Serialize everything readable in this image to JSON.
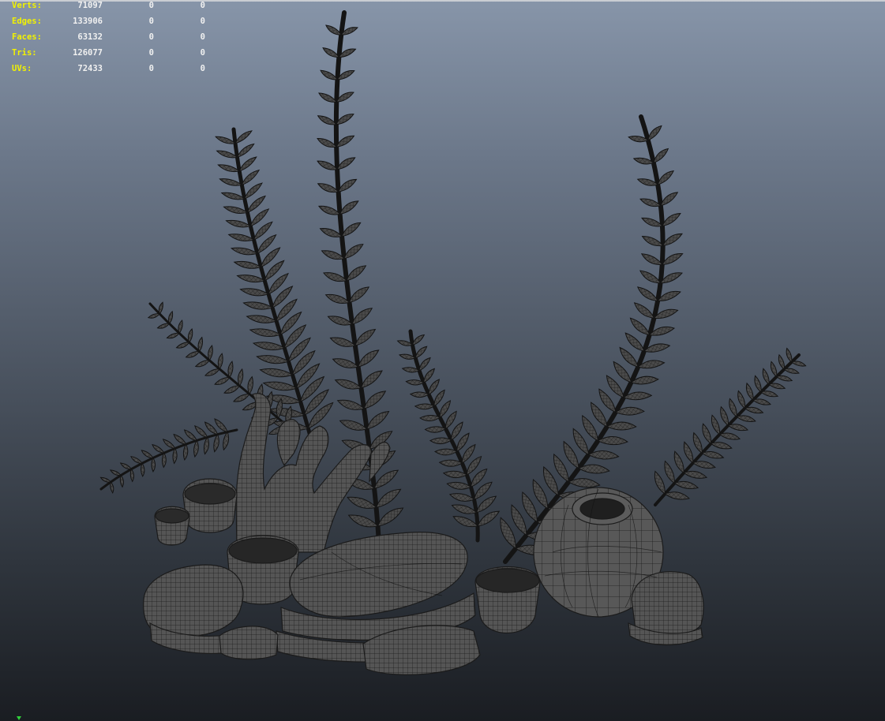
{
  "viewport": {
    "name": "maya-perspective-viewport",
    "colors": {
      "bg_top": "#8795a9",
      "bg_bottom": "#1a1d22",
      "mesh_fill": "#4f4f4f",
      "wire": "#161616",
      "hud_label": "#f2f200",
      "hud_value": "#f0f0f0"
    }
  },
  "hud": {
    "rows": [
      {
        "label": "Verts:",
        "total": "71097",
        "selected": "0",
        "component": "0"
      },
      {
        "label": "Edges:",
        "total": "133906",
        "selected": "0",
        "component": "0"
      },
      {
        "label": "Faces:",
        "total": "63132",
        "selected": "0",
        "component": "0"
      },
      {
        "label": "Tris:",
        "total": "126077",
        "selected": "0",
        "component": "0"
      },
      {
        "label": "UVs:",
        "total": "72433",
        "selected": "0",
        "component": "0"
      }
    ]
  },
  "scene": {
    "objects": [
      "fern-plant",
      "coral",
      "sponge-cups",
      "flat-rocks",
      "round-pot",
      "small-rocks"
    ]
  },
  "axis_marker_icon": "green-triangle-icon"
}
